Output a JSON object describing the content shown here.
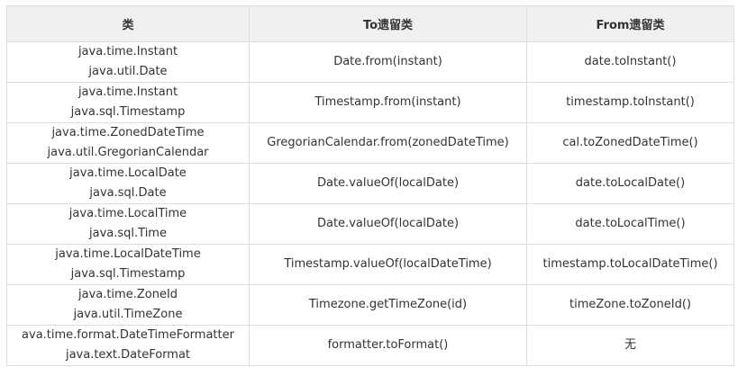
{
  "headers": [
    "类",
    "To遗留类",
    "From遗留类"
  ],
  "rows": [
    {
      "classes": [
        "java.time.Instant",
        "java.util.Date"
      ],
      "to": "Date.from(instant)",
      "from": "date.toInstant()"
    },
    {
      "classes": [
        "java.time.Instant",
        "java.sql.Timestamp"
      ],
      "to": "Timestamp.from(instant)",
      "from": "timestamp.toInstant()"
    },
    {
      "classes": [
        "java.time.ZonedDateTime",
        "java.util.GregorianCalendar"
      ],
      "to": "GregorianCalendar.from(zonedDateTime)",
      "from": "cal.toZonedDateTime()"
    },
    {
      "classes": [
        "java.time.LocalDate",
        "java.sql.Date"
      ],
      "to": "Date.valueOf(localDate)",
      "from": "date.toLocalDate()"
    },
    {
      "classes": [
        "java.time.LocalTime",
        "java.sql.Time"
      ],
      "to": "Date.valueOf(localDate)",
      "from": "date.toLocalTime()"
    },
    {
      "classes": [
        "java.time.LocalDateTime",
        "java.sql.Timestamp"
      ],
      "to": "Timestamp.valueOf(localDateTime)",
      "from": "timestamp.toLocalDateTime()"
    },
    {
      "classes": [
        "java.time.ZoneId",
        "java.util.TimeZone"
      ],
      "to": "Timezone.getTimeZone(id)",
      "from": "timeZone.toZoneId()"
    },
    {
      "classes": [
        "ava.time.format.DateTimeFormatter",
        "java.text.DateFormat"
      ],
      "to": "formatter.toFormat()",
      "from": "无"
    }
  ]
}
